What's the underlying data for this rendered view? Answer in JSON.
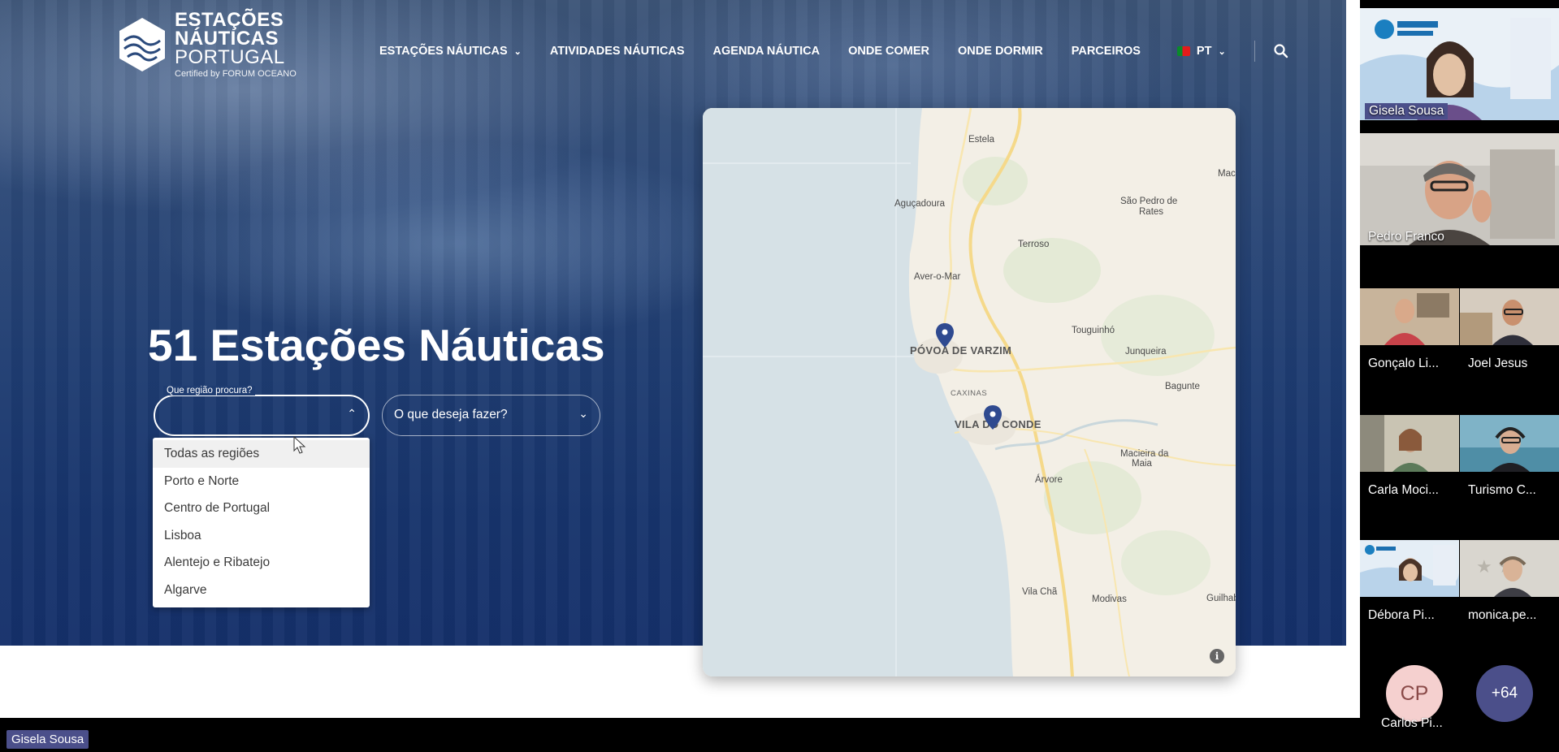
{
  "site": {
    "logo": {
      "line1": "ESTAÇÕES",
      "line2": "NÁUTICAS",
      "line3": "PORTUGAL",
      "certified": "Certified by FORUM OCEANO"
    },
    "nav": {
      "items": [
        {
          "label": "ESTAÇÕES NÁUTICAS",
          "has_dropdown": true
        },
        {
          "label": "ATIVIDADES NÁUTICAS"
        },
        {
          "label": "AGENDA NÁUTICA"
        },
        {
          "label": "ONDE COMER"
        },
        {
          "label": "ONDE DORMIR"
        },
        {
          "label": "PARCEIROS"
        }
      ],
      "language": "PT"
    },
    "hero": {
      "title": "51 Estações Náuticas",
      "region_select": {
        "label": "Que região procura?",
        "value": "",
        "open": true,
        "options": [
          "Todas as regiões",
          "Porto e Norte",
          "Centro de Portugal",
          "Lisboa",
          "Alentejo e Ribatejo",
          "Algarve"
        ],
        "highlighted": "Todas as regiões"
      },
      "activity_select": {
        "placeholder": "O que deseja fazer?"
      }
    },
    "map": {
      "labels": [
        {
          "text": "Estela",
          "kind": "normal"
        },
        {
          "text": "Aguçadoura",
          "kind": "normal"
        },
        {
          "text": "São Pedro de",
          "kind": "normal"
        },
        {
          "text": "Rates",
          "kind": "normal"
        },
        {
          "text": "Terroso",
          "kind": "normal"
        },
        {
          "text": "Aver-o-Mar",
          "kind": "normal"
        },
        {
          "text": "Touguinhó",
          "kind": "normal"
        },
        {
          "text": "Junqueira",
          "kind": "normal"
        },
        {
          "text": "PÓVOA DE VARZIM",
          "kind": "big"
        },
        {
          "text": "CAXINAS",
          "kind": "small"
        },
        {
          "text": "Bagunte",
          "kind": "normal"
        },
        {
          "text": "VILA DO CONDE",
          "kind": "big"
        },
        {
          "text": "Macieira da",
          "kind": "normal"
        },
        {
          "text": "Maia",
          "kind": "normal"
        },
        {
          "text": "Árvore",
          "kind": "normal"
        },
        {
          "text": "Vila Chã",
          "kind": "normal"
        },
        {
          "text": "Modivas",
          "kind": "normal"
        },
        {
          "text": "Guilhab",
          "kind": "normal"
        },
        {
          "text": "Mac",
          "kind": "normal"
        }
      ],
      "markers": [
        "Póvoa de Varzim",
        "Vila do Conde"
      ],
      "info_symbol": "i"
    }
  },
  "meeting": {
    "presenter_tag": "Gisela Sousa",
    "participants": [
      {
        "name": "Gisela Sousa"
      },
      {
        "name": "Pedro Franco"
      },
      {
        "name": "Gonçalo Li..."
      },
      {
        "name": "Joel Jesus"
      },
      {
        "name": "Carla Moci..."
      },
      {
        "name": "Turismo C..."
      },
      {
        "name": "Débora Pi..."
      },
      {
        "name": "monica.pe..."
      },
      {
        "name": "Carlos Pi...",
        "initials": "CP"
      }
    ],
    "more_count": "+64",
    "colors": {
      "accent": "#4b4f8a",
      "avatar_bg": "#f5d0cf",
      "avatar_fg": "#8a4a48",
      "more_bg": "#4b4f8a"
    }
  }
}
